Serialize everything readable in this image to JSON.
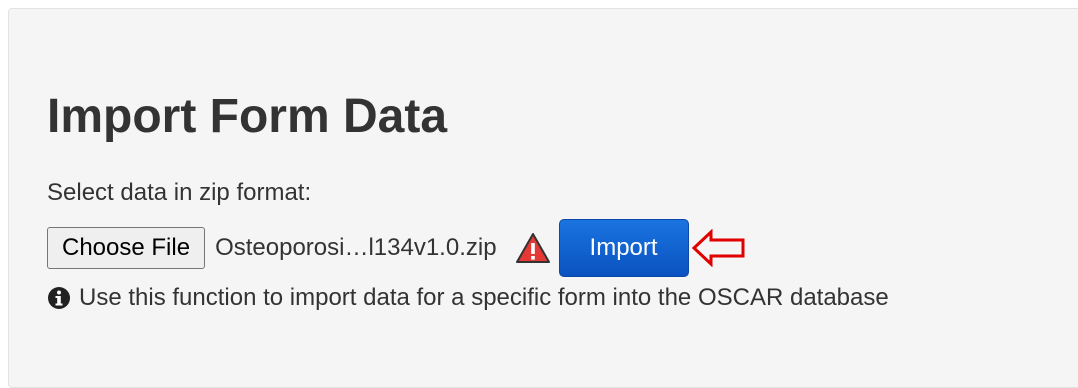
{
  "form": {
    "title": "Import Form Data",
    "select_label": "Select data in zip format:",
    "choose_file_label": "Choose File",
    "file_name": "Osteoporosi…l134v1.0.zip",
    "import_label": "Import",
    "help_text": "Use this function to import data for a specific form into the OSCAR database"
  },
  "icons": {
    "warning": "warning-icon",
    "arrow": "arrow-left-icon",
    "info": "info-circle-icon"
  },
  "colors": {
    "import_button": "#0a5cd0",
    "warning": "#e53935",
    "arrow": "#e00000",
    "panel_bg": "#f5f5f5"
  }
}
